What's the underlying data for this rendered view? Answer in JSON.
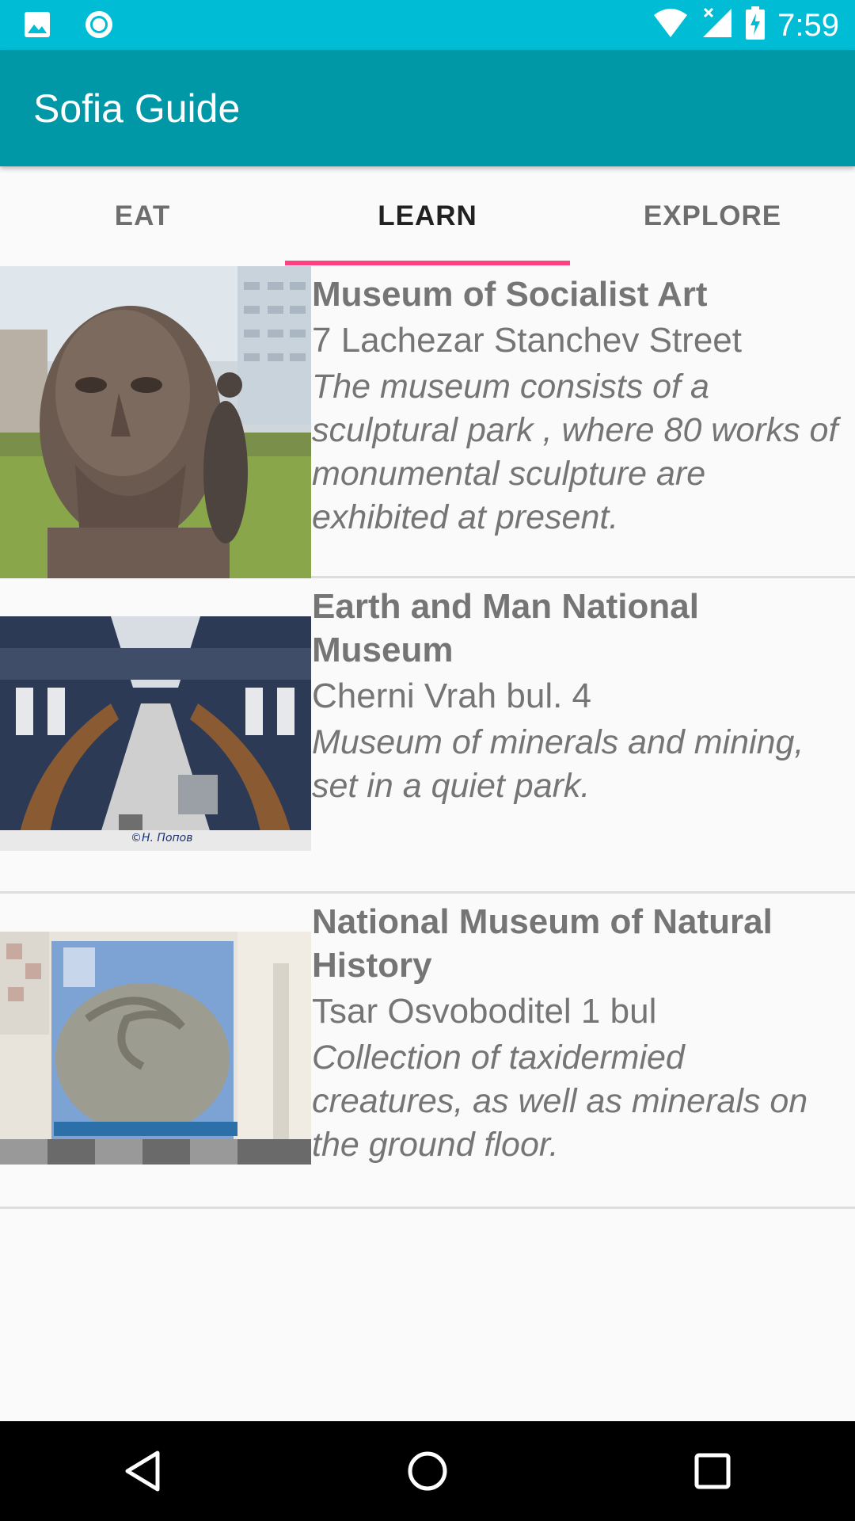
{
  "status_bar": {
    "time": "7:59",
    "icons": [
      "image-icon",
      "circle-notification-icon",
      "wifi-icon",
      "signal-icon",
      "battery-charging-icon"
    ]
  },
  "app_bar": {
    "title": "Sofia Guide"
  },
  "tabs": [
    {
      "label": "EAT",
      "active": false
    },
    {
      "label": "LEARN",
      "active": true
    },
    {
      "label": "EXPLORE",
      "active": false
    }
  ],
  "colors": {
    "status_bar": "#00bcd4",
    "app_bar": "#0097a7",
    "tab_indicator": "#ff4081",
    "text_secondary": "#757575"
  },
  "items": [
    {
      "title": "Museum of Socialist Art",
      "address": "7 Lachezar Stanchev Street",
      "description": "The museum consists of a sculptural park , where 80 works of monumental sculpture are exhibited at present."
    },
    {
      "title": "Earth and Man National Museum",
      "address": "Cherni Vrah bul. 4",
      "description": "Museum of minerals and mining, set in a quiet park.",
      "image_caption": "©Н. Попов"
    },
    {
      "title": "National Museum of Natural History",
      "address": "Tsar Osvoboditel 1 bul",
      "description": "Collection of taxidermied creatures, as well as minerals on the ground floor."
    }
  ],
  "nav_bar": {
    "buttons": [
      "back-icon",
      "home-icon",
      "recents-icon"
    ]
  }
}
